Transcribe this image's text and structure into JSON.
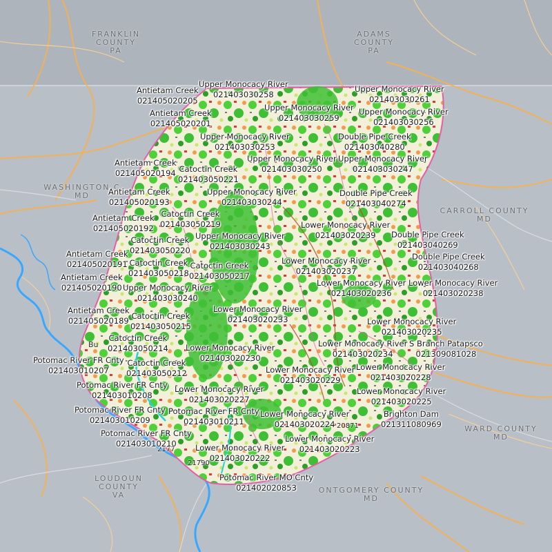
{
  "map": {
    "colors": {
      "outside": "#b9bfc6",
      "pa_region": "#aeb4bb",
      "county": "#f2f0d8",
      "forest": "#4fcf3a",
      "forest_dark": "#2e9e2b",
      "developed": "#f29a4a",
      "water": "#38a8ff",
      "roads_major": "#f2b158",
      "boundary": "#e25fa8"
    },
    "counties": [
      {
        "name": "FRANKLIN",
        "line2": "COUNTY",
        "line3": "PA"
      },
      {
        "name": "ADAMS",
        "line2": "COUNTY",
        "line3": "PA"
      },
      {
        "name": "WASHINGTON C",
        "line2": "MD",
        "line3": ""
      },
      {
        "name": "CARROLL COUNTY",
        "line2": "MD",
        "line3": ""
      },
      {
        "name": "LOUDOUN",
        "line2": "COUNTY",
        "line3": "VA"
      },
      {
        "name": "ONTGOMERY COUNTY",
        "line2": "MD",
        "line3": ""
      },
      {
        "name": "WARD COUNTY",
        "line2": "MD",
        "line3": ""
      }
    ],
    "places": [
      {
        "text": "Bu"
      }
    ],
    "road_numbers": [
      {
        "text": "21790"
      },
      {
        "text": "2177"
      },
      {
        "text": "20871"
      }
    ],
    "watersheds": [
      {
        "name": "Upper Monocacy River",
        "id": "021403030258"
      },
      {
        "name": "Antietam Creek",
        "id": "021405020205"
      },
      {
        "name": "Upper Monocacy River",
        "id": "021403030261"
      },
      {
        "name": "Antietam Creek",
        "id": "021405020201"
      },
      {
        "name": "Upper Monocacy River",
        "id": "021403030259"
      },
      {
        "name": "Upper Monocacy River",
        "id": "021403030256"
      },
      {
        "name": "Double Pipe Creek",
        "id": "021403040280"
      },
      {
        "name": "Upper Monocacy River",
        "id": "021403030253"
      },
      {
        "name": "Upper Monocacy River",
        "id": "021403030250"
      },
      {
        "name": "Upper Monocacy River",
        "id": "021403030247"
      },
      {
        "name": "Antietam Creek",
        "id": "021405020194"
      },
      {
        "name": "Catoctin Creek",
        "id": "021403050221"
      },
      {
        "name": "Antietam Creek",
        "id": "021405020193"
      },
      {
        "name": "Upper Monocacy River",
        "id": "021403030244"
      },
      {
        "name": "Double Pipe Creek",
        "id": "021403040274"
      },
      {
        "name": "Antietam Creek",
        "id": "021405020192"
      },
      {
        "name": "Catoctin Creek",
        "id": "021403050219"
      },
      {
        "name": "Lower Monocacy River",
        "id": "021403020239"
      },
      {
        "name": "Double Pipe Creek",
        "id": "021403040269"
      },
      {
        "name": "Catoctin Creek",
        "id": "021403050220"
      },
      {
        "name": "Upper Monocacy River",
        "id": "021403030243"
      },
      {
        "name": "Antietam Creek",
        "id": "021405020191"
      },
      {
        "name": "Catoctin Creek",
        "id": "021403050218"
      },
      {
        "name": "Catoctin Creek",
        "id": "021403050217"
      },
      {
        "name": "Lower Monocacy River",
        "id": "021403020237"
      },
      {
        "name": "Double Pipe Creek",
        "id": "021403040268"
      },
      {
        "name": "Antietam Creek",
        "id": "021405020190"
      },
      {
        "name": "Upper Monocacy River",
        "id": "021403030240"
      },
      {
        "name": "Lower Monocacy River",
        "id": "021403020236"
      },
      {
        "name": "Lower Monocacy River",
        "id": "021403020238"
      },
      {
        "name": "Antietam Creek",
        "id": "021405020189"
      },
      {
        "name": "Catoctin Creek",
        "id": "021403050215"
      },
      {
        "name": "Lower Monocacy River",
        "id": "021403020233"
      },
      {
        "name": "Lower Monocacy River",
        "id": "021403020235"
      },
      {
        "name": "Catoctin Creek",
        "id": "021403050214"
      },
      {
        "name": "Lower Monocacy River",
        "id": "021403020230"
      },
      {
        "name": "Lower Monocacy River",
        "id": "021403020234"
      },
      {
        "name": "S Branch Patapsco",
        "id": "021309081028"
      },
      {
        "name": "Potomac River FR Cnty",
        "id": "021403010207"
      },
      {
        "name": "Catoctin Creek",
        "id": "021403050212"
      },
      {
        "name": "Lower Monocacy River",
        "id": "021403020229"
      },
      {
        "name": "Lower Monocacy River",
        "id": "021403020228"
      },
      {
        "name": "Potomac River FR Cnty",
        "id": "021403010208"
      },
      {
        "name": "Lower Monocacy River",
        "id": "021403020227"
      },
      {
        "name": "Lower Monocacy River",
        "id": "021403020225"
      },
      {
        "name": "Potomac River FR Cnty",
        "id": "021403010209"
      },
      {
        "name": "Potomac River FR Cnty",
        "id": "021403010211"
      },
      {
        "name": "Lower Monocacy River",
        "id": "021403020224"
      },
      {
        "name": "Brighton Dam",
        "id": "021311080969"
      },
      {
        "name": "Potomac River FR Cnty",
        "id": "021403010210"
      },
      {
        "name": "Lower Monocacy River",
        "id": "021403020223"
      },
      {
        "name": "Lower Monocacy River",
        "id": "021403020222"
      },
      {
        "name": "Potomac River MO Cnty",
        "id": "021402020853"
      }
    ]
  }
}
